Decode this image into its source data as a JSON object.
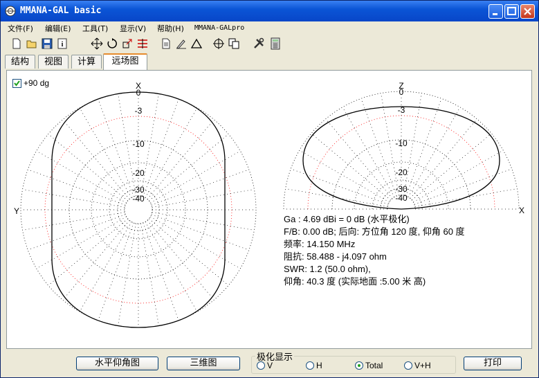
{
  "window": {
    "title": "MMANA-GAL basic"
  },
  "menu": [
    "文件(F)",
    "编辑(E)",
    "工具(T)",
    "显示(V)",
    "帮助(H)",
    "MMANA-GALpro"
  ],
  "toolbar": [
    "new-icon",
    "open-icon",
    "save-icon",
    "info-icon",
    "move-icon",
    "rotate-icon",
    "scale-icon",
    "stretch-icon",
    "document-icon",
    "edit-icon",
    "triangle-icon",
    "target-icon",
    "copy-icon",
    "tools-icon",
    "calculator-icon"
  ],
  "tabs": [
    {
      "label": "结构",
      "active": false
    },
    {
      "label": "视图",
      "active": false
    },
    {
      "label": "计算",
      "active": false
    },
    {
      "label": "远场图",
      "active": true
    }
  ],
  "checkbox": {
    "label": "+90 dg",
    "checked": true
  },
  "horizontal_plot": {
    "top_axis": "X",
    "left_axis": "Y",
    "ring_labels": [
      "0",
      "-3",
      "-10",
      "-20",
      "-30",
      "-40"
    ]
  },
  "vertical_plot": {
    "top_axis": "Z",
    "right_axis": "X",
    "ring_labels": [
      "0",
      "-3",
      "-10",
      "-20",
      "-30",
      "-40"
    ]
  },
  "info": {
    "gain": "Ga : 4.69 dBi = 0 dB  (水平极化)",
    "fb": "F/B: 0.00 dB; 后向: 方位角 120 度,  仰角 60 度",
    "freq": "频率: 14.150 MHz",
    "impedance": "阻抗: 58.488 - j4.097 ohm",
    "swr": "SWR: 1.2 (50.0 ohm),",
    "elevation": "仰角: 40.3 度 (实际地面  :5.00 米 高)"
  },
  "buttons": {
    "horiz": "水平仰角图",
    "threed": "三维图",
    "print": "打印"
  },
  "polarization": {
    "title": "极化显示",
    "options": [
      "V",
      "H",
      "Total",
      "V+H"
    ],
    "selected": "Total"
  },
  "colors": {
    "title_bar": "#0b55d6",
    "pattern": "#000000",
    "reference_circle": "#ff0000",
    "grid": "#000000"
  }
}
